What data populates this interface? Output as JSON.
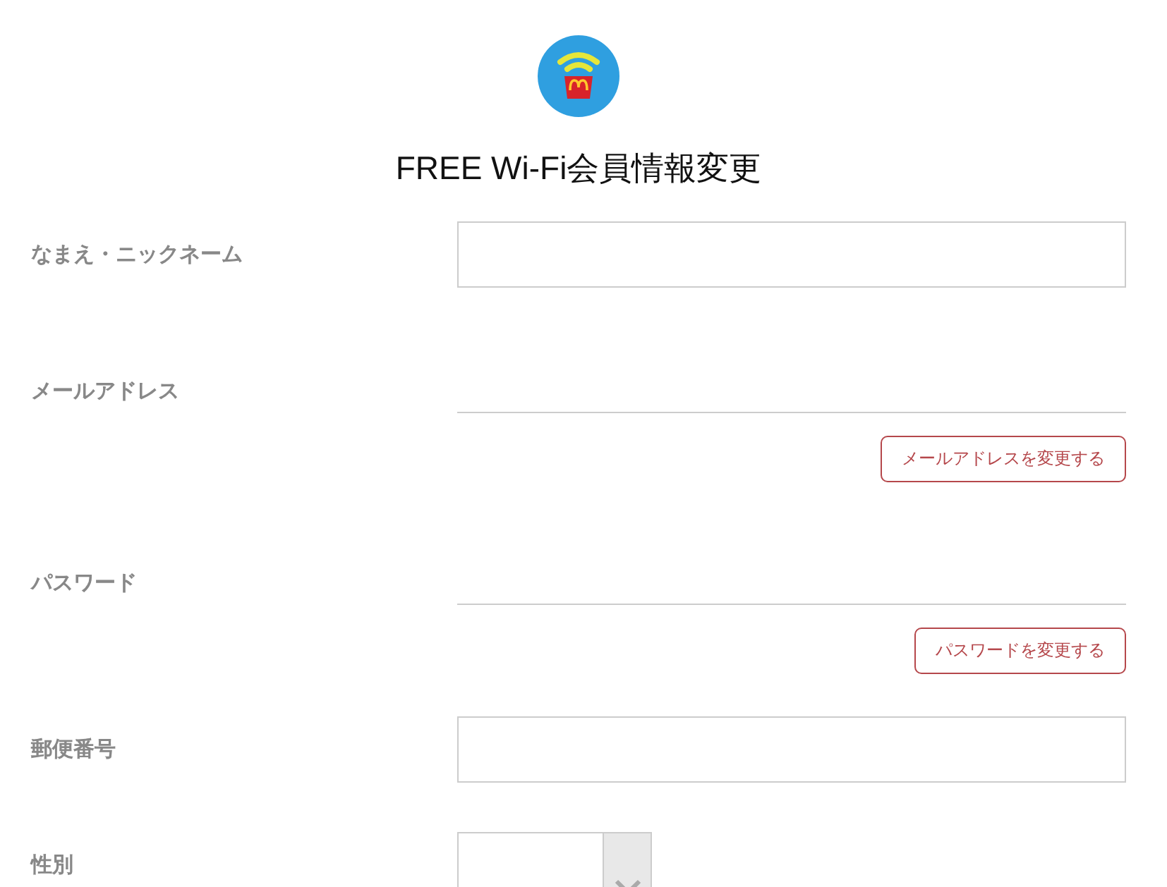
{
  "title": "FREE Wi-Fi会員情報変更",
  "fields": [
    {
      "kind": "input",
      "label": "なまえ・ニックネーム"
    },
    {
      "kind": "readonly",
      "label": "メールアドレス",
      "button": "メールアドレスを変更する"
    },
    {
      "kind": "readonly",
      "label": "パスワード",
      "button": "パスワードを変更する"
    },
    {
      "kind": "input",
      "label": "郵便番号"
    },
    {
      "kind": "select",
      "label": "性別"
    }
  ]
}
